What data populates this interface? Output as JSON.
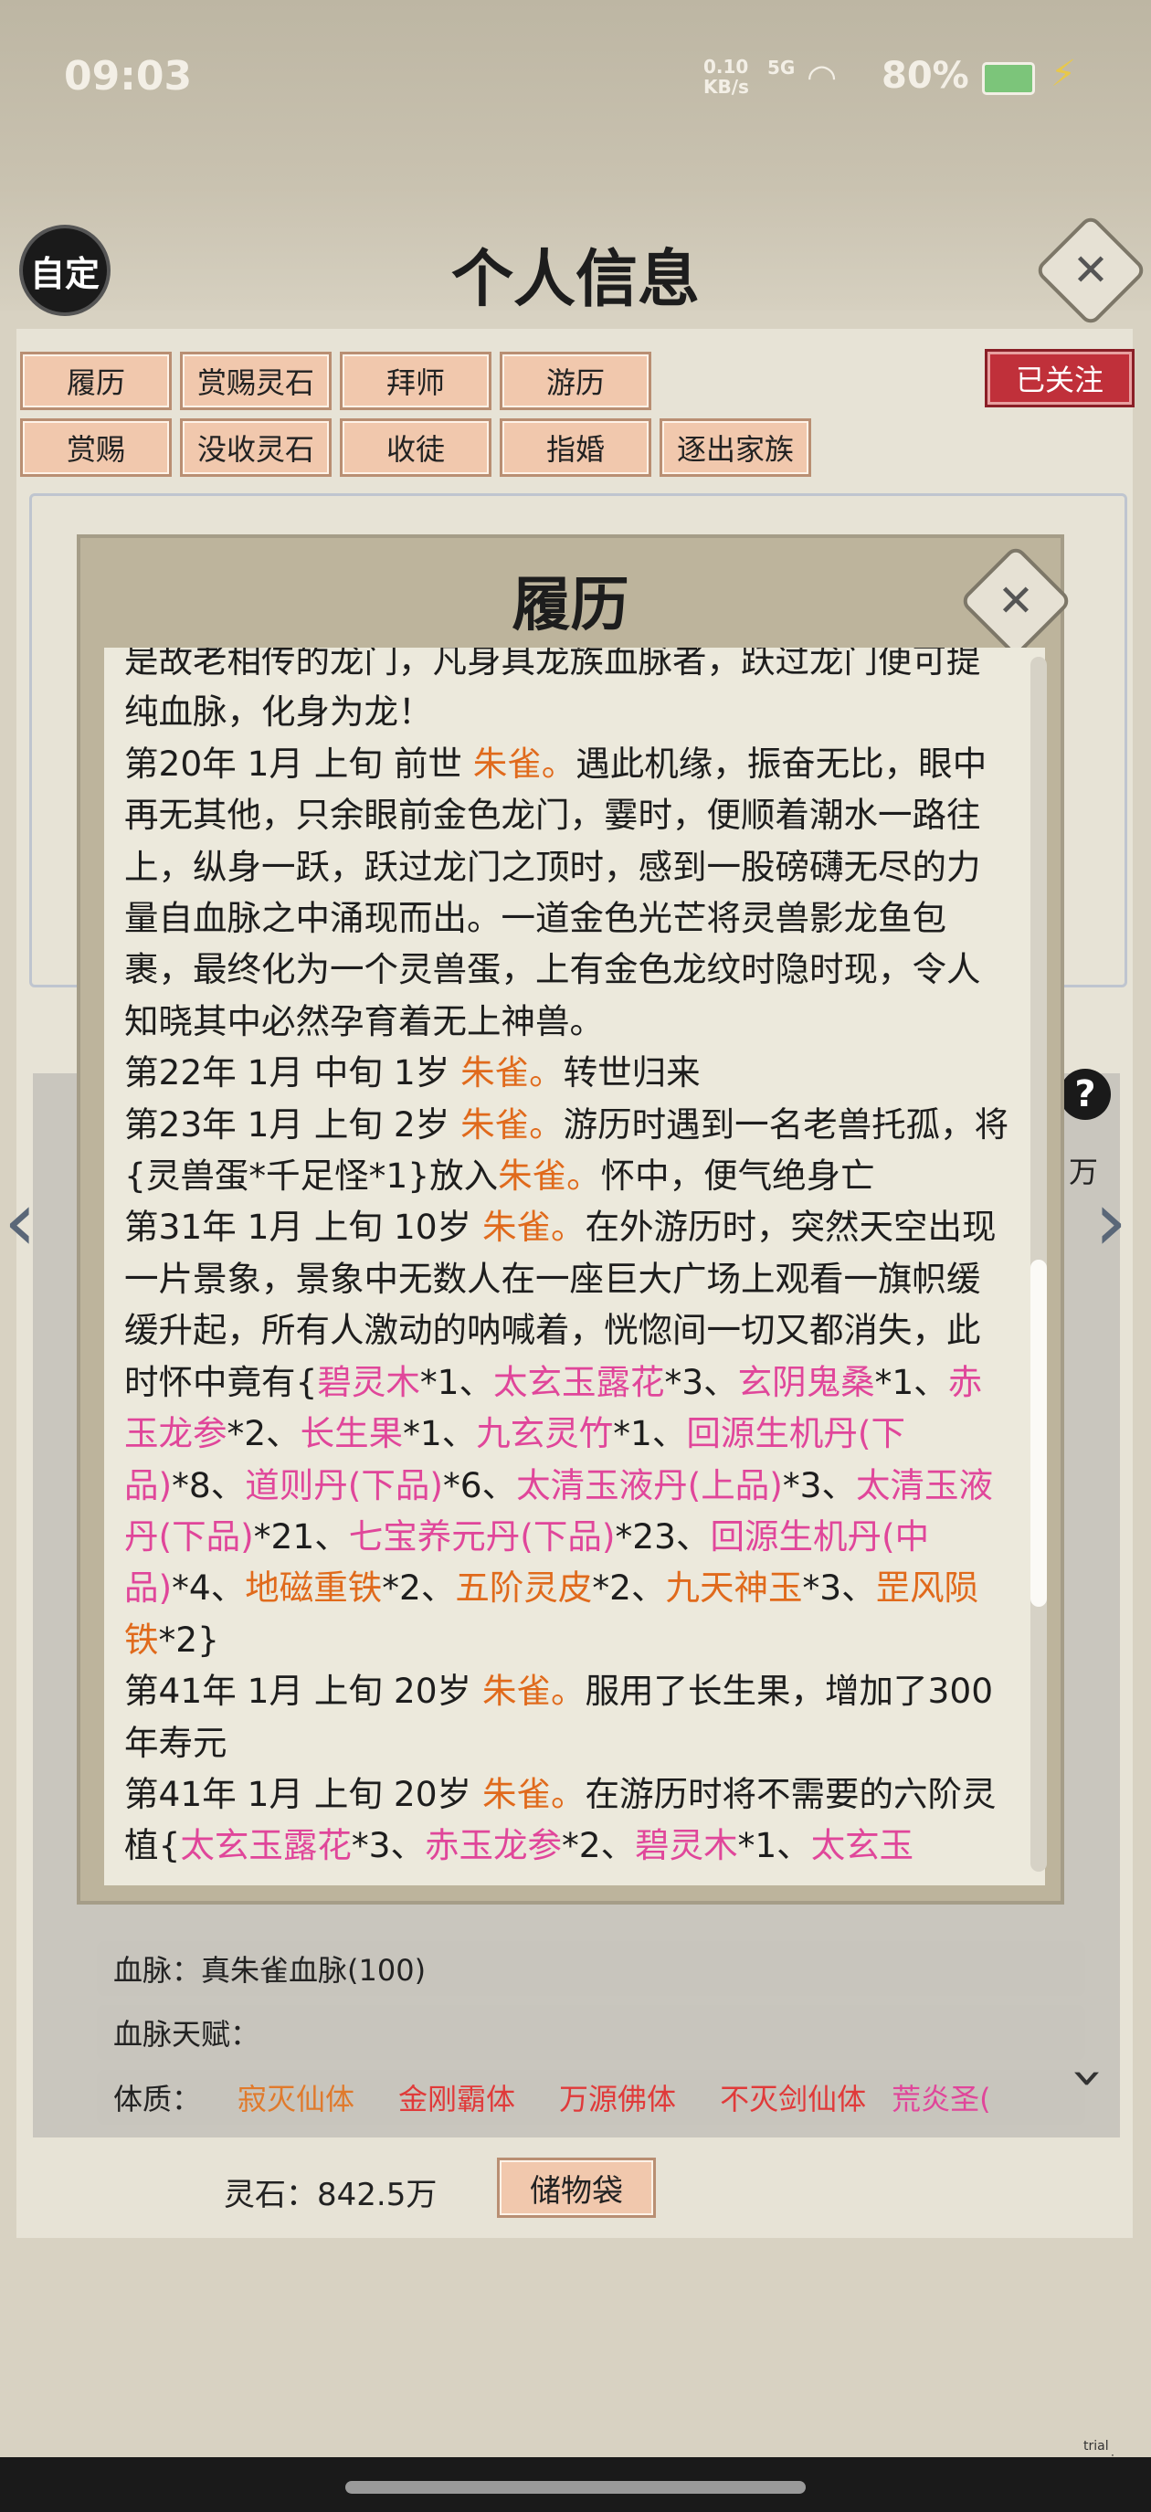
{
  "status_bar": {
    "time": "09:03",
    "net_speed": "0.10\nKB/s",
    "signal": "5G",
    "battery": "80%"
  },
  "header": {
    "custom_badge": "自定",
    "title": "个人信息",
    "close_icon": "close-icon"
  },
  "toolbar": {
    "row1": [
      "履历",
      "赏赐灵石",
      "拜师",
      "游历"
    ],
    "row2": [
      "赏赐",
      "没收灵石",
      "收徒",
      "指婚",
      "逐出家族"
    ],
    "follow": "已关注"
  },
  "bg_rows": {
    "bloodline": "血脉：真朱雀血脉(100)",
    "bloodline_talent": "血脉天赋：",
    "physique_label": "体质：",
    "physique_items": [
      {
        "text": "寂灭仙体",
        "color": "#e07a2c"
      },
      {
        "text": "金刚霸体",
        "color": "#e03a3a"
      },
      {
        "text": "万源佛体",
        "color": "#e03a3a"
      },
      {
        "text": "不灭剑仙体",
        "color": "#e03a3a"
      },
      {
        "text": "荒炎圣(",
        "color": "#e0469a"
      }
    ],
    "spirit_stone": "灵石：842.5万",
    "storage_bag": "储物袋",
    "help": "?",
    "wan": "万"
  },
  "modal": {
    "title": "履历",
    "entries": [
      [
        {
          "t": "是故老相传的龙门，凡身具龙族血脉者，跃过龙门便可提纯血脉，化身为龙！"
        }
      ],
      [
        {
          "t": "第20年 1月 上旬 前世 "
        },
        {
          "t": "朱雀。",
          "c": "o"
        },
        {
          "t": "遇此机缘，振奋无比，眼中再无其他，只余眼前金色龙门，霎时，便顺着潮水一路往上，纵身一跃，跃过龙门之顶时，感到一股磅礴无尽的力量自血脉之中涌现而出。一道金色光芒将灵兽影龙鱼包裹，最终化为一个灵兽蛋，上有金色龙纹时隐时现，令人知晓其中必然孕育着无上神兽。"
        }
      ],
      [
        {
          "t": "第22年 1月 中旬  1岁  "
        },
        {
          "t": "朱雀。",
          "c": "o"
        },
        {
          "t": "转世归来"
        }
      ],
      [
        {
          "t": "第23年 1月 上旬  2岁  "
        },
        {
          "t": "朱雀。",
          "c": "o"
        },
        {
          "t": "游历时遇到一名老兽托孤，将{灵兽蛋*千足怪*1}放入"
        },
        {
          "t": "朱雀。",
          "c": "o"
        },
        {
          "t": "怀中，便气绝身亡"
        }
      ],
      [
        {
          "t": "第31年 1月 上旬  10岁  "
        },
        {
          "t": "朱雀。",
          "c": "o"
        },
        {
          "t": "在外游历时，突然天空出现一片景象，景象中无数人在一座巨大广场上观看一旗帜缓缓升起，所有人激动的呐喊着，恍惚间一切又都消失，此时怀中竟有{"
        },
        {
          "t": "碧灵木",
          "c": "p"
        },
        {
          "t": "*1、"
        },
        {
          "t": "太玄玉露花",
          "c": "p"
        },
        {
          "t": "*3、"
        },
        {
          "t": "玄阴鬼桑",
          "c": "p"
        },
        {
          "t": "*1、"
        },
        {
          "t": "赤玉龙参",
          "c": "p"
        },
        {
          "t": "*2、"
        },
        {
          "t": "长生果",
          "c": "p"
        },
        {
          "t": "*1、"
        },
        {
          "t": "九玄灵竹",
          "c": "p"
        },
        {
          "t": "*1、"
        },
        {
          "t": "回源生机丹(下品)",
          "c": "p"
        },
        {
          "t": "*8、"
        },
        {
          "t": "道则丹(下品)",
          "c": "p"
        },
        {
          "t": "*6、"
        },
        {
          "t": "太清玉液丹(上品)",
          "c": "p"
        },
        {
          "t": "*3、"
        },
        {
          "t": "太清玉液丹(下品)",
          "c": "p"
        },
        {
          "t": "*21、"
        },
        {
          "t": "七宝养元丹(下品)",
          "c": "p"
        },
        {
          "t": "*23、"
        },
        {
          "t": "回源生机丹(中品)",
          "c": "p"
        },
        {
          "t": "*4、"
        },
        {
          "t": "地磁重铁",
          "c": "o"
        },
        {
          "t": "*2、"
        },
        {
          "t": "五阶灵皮",
          "c": "o"
        },
        {
          "t": "*2、"
        },
        {
          "t": "九天神玉",
          "c": "o"
        },
        {
          "t": "*3、"
        },
        {
          "t": "罡风陨铁",
          "c": "o"
        },
        {
          "t": "*2}"
        }
      ],
      [
        {
          "t": "第41年 1月 上旬  20岁  "
        },
        {
          "t": "朱雀。",
          "c": "o"
        },
        {
          "t": "服用了长生果，增加了300年寿元"
        }
      ],
      [
        {
          "t": "第41年 1月 上旬  20岁  "
        },
        {
          "t": "朱雀。",
          "c": "o"
        },
        {
          "t": "在游历时将不需要的六阶灵植{"
        },
        {
          "t": "太玄玉露花",
          "c": "p"
        },
        {
          "t": "*3、"
        },
        {
          "t": "赤玉龙参",
          "c": "p"
        },
        {
          "t": "*2、"
        },
        {
          "t": "碧灵木",
          "c": "p"
        },
        {
          "t": "*1、"
        },
        {
          "t": "太玄玉",
          "c": "p"
        }
      ]
    ]
  },
  "watermark": "trial version"
}
